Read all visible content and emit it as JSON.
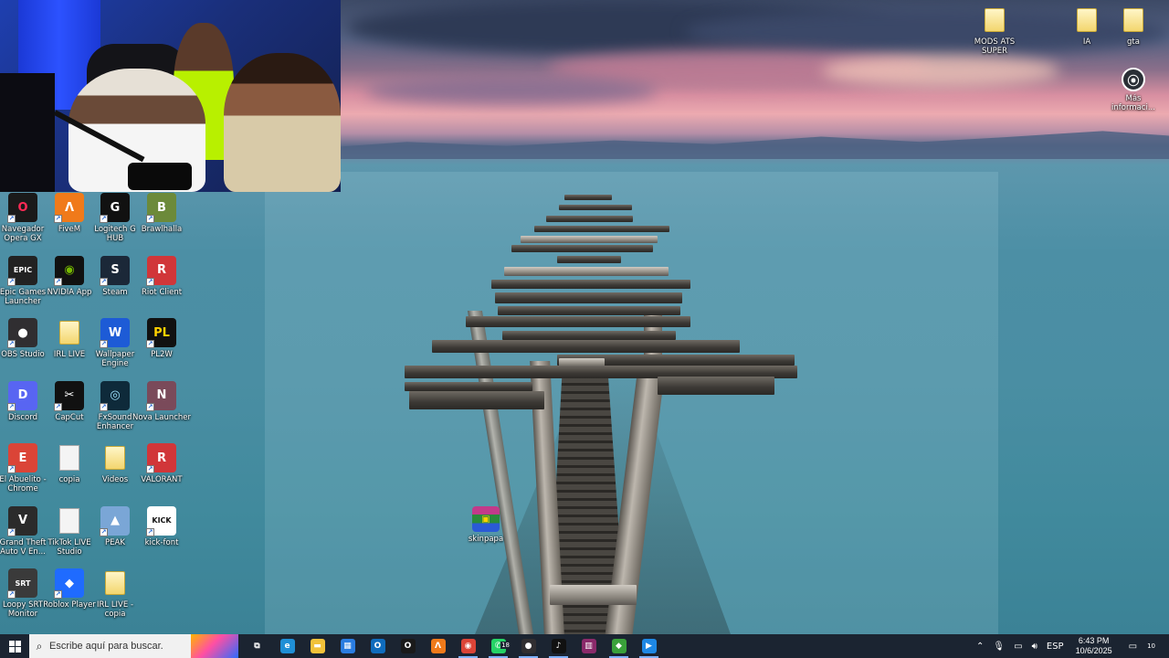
{
  "desktop_icons_left": [
    {
      "label": "Navegador Opera GX",
      "icon": "opera-gx-icon",
      "color": "#1a1a1a",
      "glyph": "O",
      "fg": "#ff2a55"
    },
    {
      "label": "FiveM",
      "icon": "fivem-icon",
      "color": "#f07a1a",
      "glyph": "Λ",
      "fg": "#ffffff"
    },
    {
      "label": "Logitech G HUB",
      "icon": "logitech-ghub-icon",
      "color": "#111111",
      "glyph": "G",
      "fg": "#ffffff"
    },
    {
      "label": "Brawlhalla",
      "icon": "brawlhalla-icon",
      "color": "#6c8a3a",
      "glyph": "B",
      "fg": "#ffffff"
    },
    {
      "label": "Epic Games Launcher",
      "icon": "epic-games-icon",
      "color": "#222222",
      "glyph": "EPIC",
      "fg": "#ffffff"
    },
    {
      "label": "NVIDIA App",
      "icon": "nvidia-icon",
      "color": "#111111",
      "glyph": "◉",
      "fg": "#76b900"
    },
    {
      "label": "Steam",
      "icon": "steam-icon",
      "color": "#1b2838",
      "glyph": "S",
      "fg": "#ffffff"
    },
    {
      "label": "Riot Client",
      "icon": "riot-client-icon",
      "color": "#d13639",
      "glyph": "R",
      "fg": "#ffffff"
    },
    {
      "label": "OBS Studio",
      "icon": "obs-studio-icon",
      "color": "#302e31",
      "glyph": "●",
      "fg": "#ffffff"
    },
    {
      "label": "IRL LIVE",
      "icon": "folder-icon",
      "color": "",
      "glyph": "",
      "fg": ""
    },
    {
      "label": "Wallpaper Engine",
      "icon": "wallpaper-engine-icon",
      "color": "#1d5bd6",
      "glyph": "W",
      "fg": "#ffffff"
    },
    {
      "label": "PL2W",
      "icon": "pl2w-icon",
      "color": "#111111",
      "glyph": "PL",
      "fg": "#ffd200"
    },
    {
      "label": "Discord",
      "icon": "discord-icon",
      "color": "#5865f2",
      "glyph": "D",
      "fg": "#ffffff"
    },
    {
      "label": "CapCut",
      "icon": "capcut-icon",
      "color": "#111111",
      "glyph": "✂",
      "fg": "#ffffff"
    },
    {
      "label": "FxSound Enhancer",
      "icon": "fxsound-icon",
      "color": "#0e2a3a",
      "glyph": "◎",
      "fg": "#9fe3ff"
    },
    {
      "label": "Nova Launcher",
      "icon": "nova-launcher-icon",
      "color": "#7a4a5a",
      "glyph": "N",
      "fg": "#ffffff"
    },
    {
      "label": "El Abuelito - Chrome",
      "icon": "chrome-icon",
      "color": "#db4437",
      "glyph": "E",
      "fg": "#ffffff"
    },
    {
      "label": "copia",
      "icon": "document-icon",
      "color": "",
      "glyph": "",
      "fg": ""
    },
    {
      "label": "Videos",
      "icon": "folder-icon",
      "color": "",
      "glyph": "",
      "fg": ""
    },
    {
      "label": "VALORANT",
      "icon": "valorant-icon",
      "color": "#d13639",
      "glyph": "R",
      "fg": "#ffffff"
    },
    {
      "label": "Grand Theft Auto V En...",
      "icon": "gta-v-icon",
      "color": "#2b2b2b",
      "glyph": "V",
      "fg": "#ffffff"
    },
    {
      "label": "TikTok LIVE Studio",
      "icon": "document-icon",
      "color": "",
      "glyph": "",
      "fg": ""
    },
    {
      "label": "PEAK",
      "icon": "peak-icon",
      "color": "#7aa6d6",
      "glyph": "▲",
      "fg": "#ffffff"
    },
    {
      "label": "kick-font",
      "icon": "kick-font-icon",
      "color": "#ffffff",
      "glyph": "KICK",
      "fg": "#111111"
    },
    {
      "label": "Loopy SRT Monitor",
      "icon": "loopy-srt-icon",
      "color": "#3a3a3a",
      "glyph": "SRT",
      "fg": "#ffffff"
    },
    {
      "label": "Roblox Player",
      "icon": "roblox-icon",
      "color": "#1f6bff",
      "glyph": "◆",
      "fg": "#ffffff"
    },
    {
      "label": "IRL LIVE - copia",
      "icon": "folder-icon",
      "color": "",
      "glyph": "",
      "fg": ""
    }
  ],
  "desktop_icons_right": [
    {
      "label": "MODS ATS SUPER",
      "icon": "folder-icon"
    },
    {
      "label": "IA",
      "icon": "folder-icon"
    },
    {
      "label": "gta",
      "icon": "folder-icon"
    },
    {
      "label": "Más informaci...",
      "icon": "info-icon"
    }
  ],
  "desktop_icon_center": {
    "label": "skinpapa",
    "icon": "winrar-archive-icon"
  },
  "taskbar": {
    "search_placeholder": "Escribe aquí para buscar.",
    "apps": [
      {
        "name": "task-view-icon",
        "color": "#1b2431",
        "glyph": "⧉",
        "active": false
      },
      {
        "name": "edge-icon",
        "color": "#1f8fd6",
        "glyph": "e",
        "active": false
      },
      {
        "name": "file-explorer-icon",
        "color": "#f2c23a",
        "glyph": "▬",
        "active": false
      },
      {
        "name": "microsoft-store-icon",
        "color": "#2a7de1",
        "glyph": "▦",
        "active": false
      },
      {
        "name": "outlook-icon",
        "color": "#0f6cbd",
        "glyph": "O",
        "active": false
      },
      {
        "name": "opera-gx-icon",
        "color": "#1a1a1a",
        "glyph": "O",
        "active": false
      },
      {
        "name": "fivem-icon",
        "color": "#f07a1a",
        "glyph": "Λ",
        "active": false
      },
      {
        "name": "chrome-icon",
        "color": "#db4437",
        "glyph": "◉",
        "active": true
      },
      {
        "name": "whatsapp-icon",
        "color": "#25d366",
        "glyph": "✆",
        "active": true,
        "badge": "18"
      },
      {
        "name": "obs-studio-icon",
        "color": "#302e31",
        "glyph": "●",
        "active": true
      },
      {
        "name": "tiktok-icon",
        "color": "#111111",
        "glyph": "♪",
        "active": true
      },
      {
        "name": "winrar-icon",
        "color": "#8a2a6a",
        "glyph": "▥",
        "active": false
      },
      {
        "name": "green-app-icon",
        "color": "#3aa13a",
        "glyph": "◆",
        "active": true
      },
      {
        "name": "media-player-icon",
        "color": "#1e88e5",
        "glyph": "▶",
        "active": true
      }
    ],
    "tray": {
      "language": "ESP",
      "time": "6:43 PM",
      "date": "10/6/2025",
      "notifications": "10"
    }
  }
}
